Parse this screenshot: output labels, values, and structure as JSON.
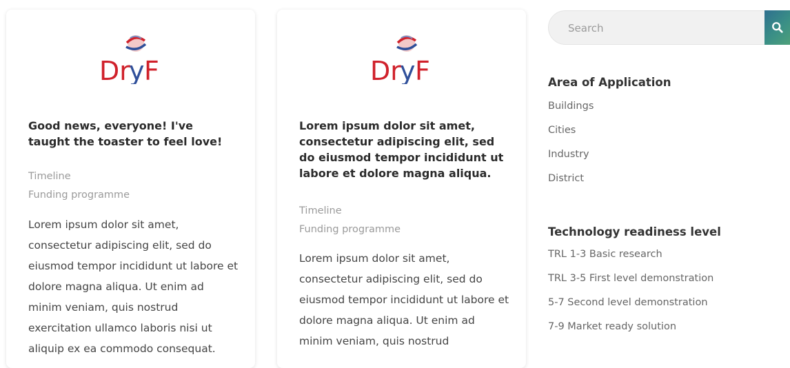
{
  "posts": [
    {
      "logo_text": "DryF",
      "title": "Good news, everyone! I've taught the toaster to feel love!",
      "timeline_label": "Timeline",
      "funding_label": "Funding programme",
      "description": "Lorem ipsum dolor sit amet, consectetur adipiscing elit, sed do eiusmod tempor incididunt ut labore et dolore magna aliqua. Ut enim ad minim veniam, quis nostrud exercitation ullamco laboris nisi ut aliquip ex ea commodo consequat."
    },
    {
      "logo_text": "DryF",
      "title": "Lorem ipsum dolor sit amet, consectetur adipiscing elit, sed do eiusmod tempor incididunt ut labore et dolore magna aliqua.",
      "timeline_label": "Timeline",
      "funding_label": "Funding programme",
      "description": "Lorem ipsum dolor sit amet, consectetur adipiscing elit, sed do eiusmod tempor incididunt ut labore et dolore magna aliqua. Ut enim ad minim veniam, quis nostrud"
    }
  ],
  "search": {
    "placeholder": "Search",
    "icon": "search-icon"
  },
  "sidebar": {
    "area": {
      "heading": "Area of Application",
      "items": [
        "Buildings",
        "Cities",
        "Industry",
        "District"
      ]
    },
    "trl": {
      "heading": "Technology readiness level",
      "items": [
        "TRL 1-3 Basic research",
        "TRL 3-5 First level demonstration",
        "5-7 Second level demonstration",
        "7-9 Market ready solution"
      ]
    }
  },
  "colors": {
    "logo_red": "#d0212b",
    "logo_blue": "#2f4f9a",
    "search_button": "#3a8f86"
  }
}
